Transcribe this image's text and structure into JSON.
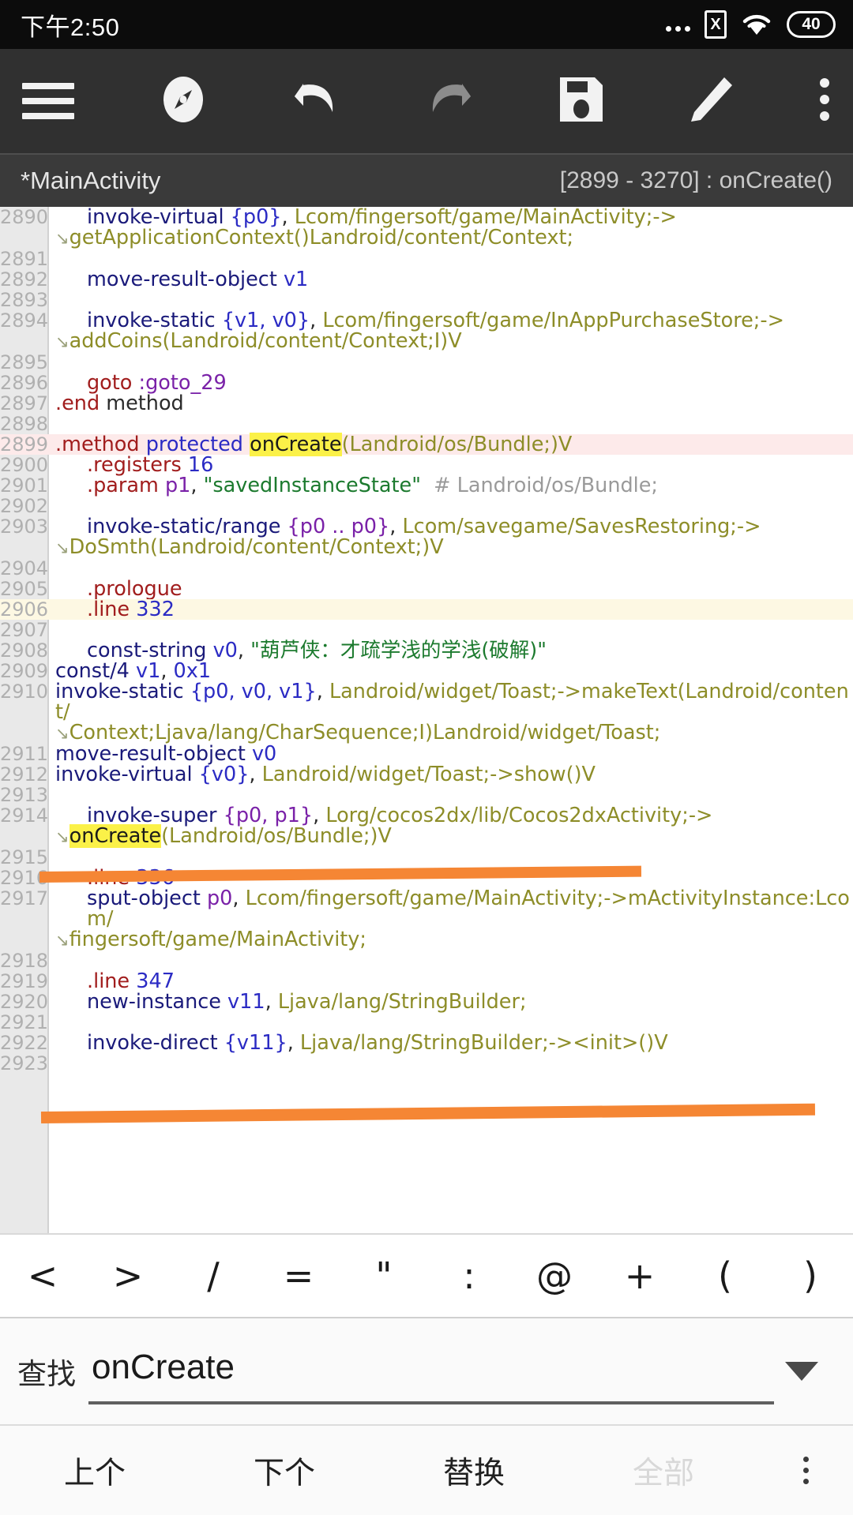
{
  "statusbar": {
    "time": "下午2:50",
    "battery": "40",
    "sim_glyph": "X",
    "icons": [
      "ellipsis-icon",
      "sim-x-icon",
      "wifi-icon",
      "battery-icon"
    ]
  },
  "toolbar": {
    "items": [
      {
        "name": "menu-button",
        "icon": "hamburger-icon",
        "enabled": true
      },
      {
        "name": "navigate-button",
        "icon": "compass-icon",
        "enabled": true
      },
      {
        "name": "undo-button",
        "icon": "undo-icon",
        "enabled": true
      },
      {
        "name": "redo-button",
        "icon": "redo-icon",
        "enabled": false
      },
      {
        "name": "save-button",
        "icon": "floppy-save-icon",
        "enabled": true
      },
      {
        "name": "edit-button",
        "icon": "pencil-icon",
        "enabled": true
      },
      {
        "name": "overflow-button",
        "icon": "more-vertical-icon",
        "enabled": true
      }
    ]
  },
  "breadcrumb": {
    "file": "*MainActivity",
    "range": "[2899 - 3270] : onCreate()"
  },
  "editor": {
    "search_term": "onCreate",
    "lines": [
      {
        "n": "2890",
        "indent": true,
        "wrap": false,
        "hl": "",
        "tokens": [
          {
            "t": "invoke-virtual",
            "c": "t-op"
          },
          {
            "t": " ",
            "c": "t-plain"
          },
          {
            "t": "{p0}",
            "c": "t-reg"
          },
          {
            "t": ", ",
            "c": "t-plain"
          },
          {
            "t": "Lcom/fingersoft/game/MainActivity;->",
            "c": "t-type"
          }
        ]
      },
      {
        "n": "",
        "indent": false,
        "wrap": true,
        "hl": "",
        "tokens": [
          {
            "t": "getApplicationContext()Landroid/content/Context;",
            "c": "t-type"
          }
        ]
      },
      {
        "n": "2891",
        "indent": false,
        "wrap": false,
        "hl": "",
        "tokens": []
      },
      {
        "n": "2892",
        "indent": true,
        "wrap": false,
        "hl": "",
        "tokens": [
          {
            "t": "move-result-object",
            "c": "t-op"
          },
          {
            "t": " ",
            "c": "t-plain"
          },
          {
            "t": "v1",
            "c": "t-reg"
          }
        ]
      },
      {
        "n": "2893",
        "indent": false,
        "wrap": false,
        "hl": "",
        "tokens": []
      },
      {
        "n": "2894",
        "indent": true,
        "wrap": false,
        "hl": "",
        "tokens": [
          {
            "t": "invoke-static",
            "c": "t-op"
          },
          {
            "t": " ",
            "c": "t-plain"
          },
          {
            "t": "{v1, v0}",
            "c": "t-reg"
          },
          {
            "t": ", ",
            "c": "t-plain"
          },
          {
            "t": "Lcom/fingersoft/game/InAppPurchaseStore;->",
            "c": "t-type"
          }
        ]
      },
      {
        "n": "",
        "indent": false,
        "wrap": true,
        "hl": "",
        "tokens": [
          {
            "t": "addCoins(Landroid/content/Context;I)V",
            "c": "t-type"
          }
        ]
      },
      {
        "n": "2895",
        "indent": false,
        "wrap": false,
        "hl": "",
        "tokens": []
      },
      {
        "n": "2896",
        "indent": true,
        "wrap": false,
        "hl": "",
        "tokens": [
          {
            "t": "goto",
            "c": "t-dir"
          },
          {
            "t": " ",
            "c": "t-plain"
          },
          {
            "t": ":goto_29",
            "c": "t-lbl"
          }
        ]
      },
      {
        "n": "2897",
        "indent": false,
        "wrap": false,
        "hl": "",
        "tokens": [
          {
            "t": ".end",
            "c": "t-dir"
          },
          {
            "t": " ",
            "c": "t-plain"
          },
          {
            "t": "method",
            "c": "t-plain"
          }
        ]
      },
      {
        "n": "2898",
        "indent": false,
        "wrap": false,
        "hl": "",
        "tokens": []
      },
      {
        "n": "2899",
        "indent": false,
        "wrap": false,
        "hl": "hl-pink",
        "tokens": [
          {
            "t": ".method",
            "c": "t-dir"
          },
          {
            "t": " ",
            "c": "t-plain"
          },
          {
            "t": "protected",
            "c": "t-kw"
          },
          {
            "t": " ",
            "c": "t-plain"
          },
          {
            "t": "onCreate",
            "c": "t-mark"
          },
          {
            "t": "(Landroid/os/Bundle;)V",
            "c": "t-type"
          }
        ]
      },
      {
        "n": "2900",
        "indent": true,
        "wrap": false,
        "hl": "",
        "tokens": [
          {
            "t": ".registers",
            "c": "t-dir"
          },
          {
            "t": " ",
            "c": "t-plain"
          },
          {
            "t": "16",
            "c": "t-num"
          }
        ]
      },
      {
        "n": "2901",
        "indent": true,
        "wrap": false,
        "hl": "",
        "tokens": [
          {
            "t": ".param",
            "c": "t-dir"
          },
          {
            "t": " ",
            "c": "t-plain"
          },
          {
            "t": "p1",
            "c": "t-preg"
          },
          {
            "t": ", ",
            "c": "t-plain"
          },
          {
            "t": "\"savedInstanceState\"",
            "c": "t-str"
          },
          {
            "t": "  ",
            "c": "t-plain"
          },
          {
            "t": "# Landroid/os/Bundle;",
            "c": "t-cmt"
          }
        ]
      },
      {
        "n": "2902",
        "indent": false,
        "wrap": false,
        "hl": "",
        "tokens": []
      },
      {
        "n": "2903",
        "indent": true,
        "wrap": false,
        "hl": "",
        "tokens": [
          {
            "t": "invoke-static/range",
            "c": "t-op"
          },
          {
            "t": " ",
            "c": "t-plain"
          },
          {
            "t": "{p0 .. p0}",
            "c": "t-preg"
          },
          {
            "t": ", ",
            "c": "t-plain"
          },
          {
            "t": "Lcom/savegame/SavesRestoring;->",
            "c": "t-type"
          }
        ]
      },
      {
        "n": "",
        "indent": false,
        "wrap": true,
        "hl": "",
        "tokens": [
          {
            "t": "DoSmth(Landroid/content/Context;)V",
            "c": "t-type"
          }
        ]
      },
      {
        "n": "2904",
        "indent": false,
        "wrap": false,
        "hl": "",
        "tokens": []
      },
      {
        "n": "2905",
        "indent": true,
        "wrap": false,
        "hl": "",
        "tokens": [
          {
            "t": ".prologue",
            "c": "t-dir"
          }
        ]
      },
      {
        "n": "2906",
        "indent": true,
        "wrap": false,
        "hl": "hl-cream",
        "tokens": [
          {
            "t": ".line",
            "c": "t-dir"
          },
          {
            "t": " ",
            "c": "t-plain"
          },
          {
            "t": "332",
            "c": "t-num"
          }
        ]
      },
      {
        "n": "2907",
        "indent": false,
        "wrap": false,
        "hl": "",
        "tokens": []
      },
      {
        "n": "2908",
        "indent": true,
        "wrap": false,
        "hl": "",
        "tokens": [
          {
            "t": "const-string",
            "c": "t-op"
          },
          {
            "t": " ",
            "c": "t-plain"
          },
          {
            "t": "v0",
            "c": "t-reg"
          },
          {
            "t": ", ",
            "c": "t-plain"
          },
          {
            "t": "\"葫芦侠：才疏学浅的学浅(破解)\"",
            "c": "t-str"
          }
        ]
      },
      {
        "n": "2909",
        "indent": false,
        "wrap": false,
        "hl": "",
        "tokens": [
          {
            "t": "const/4",
            "c": "t-op"
          },
          {
            "t": " ",
            "c": "t-plain"
          },
          {
            "t": "v1",
            "c": "t-reg"
          },
          {
            "t": ", ",
            "c": "t-plain"
          },
          {
            "t": "0x1",
            "c": "t-num"
          }
        ]
      },
      {
        "n": "2910",
        "indent": false,
        "wrap": false,
        "hl": "",
        "tokens": [
          {
            "t": "invoke-static",
            "c": "t-op"
          },
          {
            "t": " ",
            "c": "t-plain"
          },
          {
            "t": "{p0, v0, v1}",
            "c": "t-reg"
          },
          {
            "t": ", ",
            "c": "t-plain"
          },
          {
            "t": "Landroid/widget/Toast;->makeText(Landroid/content/",
            "c": "t-type"
          }
        ]
      },
      {
        "n": "",
        "indent": false,
        "wrap": true,
        "hl": "",
        "tokens": [
          {
            "t": "Context;Ljava/lang/CharSequence;I)Landroid/widget/Toast;",
            "c": "t-type"
          }
        ]
      },
      {
        "n": "2911",
        "indent": false,
        "wrap": false,
        "hl": "",
        "tokens": [
          {
            "t": "move-result-object",
            "c": "t-op"
          },
          {
            "t": " ",
            "c": "t-plain"
          },
          {
            "t": "v0",
            "c": "t-reg"
          }
        ]
      },
      {
        "n": "2912",
        "indent": false,
        "wrap": false,
        "hl": "",
        "tokens": [
          {
            "t": "invoke-virtual",
            "c": "t-op"
          },
          {
            "t": " ",
            "c": "t-plain"
          },
          {
            "t": "{v0}",
            "c": "t-reg"
          },
          {
            "t": ", ",
            "c": "t-plain"
          },
          {
            "t": "Landroid/widget/Toast;->show()V",
            "c": "t-type"
          }
        ]
      },
      {
        "n": "2913",
        "indent": false,
        "wrap": false,
        "hl": "",
        "tokens": []
      },
      {
        "n": "2914",
        "indent": true,
        "wrap": false,
        "hl": "",
        "tokens": [
          {
            "t": "invoke-super",
            "c": "t-op"
          },
          {
            "t": " ",
            "c": "t-plain"
          },
          {
            "t": "{p0, p1}",
            "c": "t-preg"
          },
          {
            "t": ", ",
            "c": "t-plain"
          },
          {
            "t": "Lorg/cocos2dx/lib/Cocos2dxActivity;->",
            "c": "t-type"
          }
        ]
      },
      {
        "n": "",
        "indent": false,
        "wrap": true,
        "hl": "",
        "tokens": [
          {
            "t": "onCreate",
            "c": "t-mark"
          },
          {
            "t": "(Landroid/os/Bundle;)V",
            "c": "t-type"
          }
        ]
      },
      {
        "n": "2915",
        "indent": false,
        "wrap": false,
        "hl": "",
        "tokens": []
      },
      {
        "n": "2916",
        "indent": true,
        "wrap": false,
        "hl": "",
        "tokens": [
          {
            "t": ".line",
            "c": "t-dir"
          },
          {
            "t": " ",
            "c": "t-plain"
          },
          {
            "t": "336",
            "c": "t-num"
          }
        ]
      },
      {
        "n": "2917",
        "indent": true,
        "wrap": false,
        "hl": "",
        "tokens": [
          {
            "t": "sput-object",
            "c": "t-op"
          },
          {
            "t": " ",
            "c": "t-plain"
          },
          {
            "t": "p0",
            "c": "t-preg"
          },
          {
            "t": ", ",
            "c": "t-plain"
          },
          {
            "t": "Lcom/fingersoft/game/MainActivity;->mActivityInstance:Lcom/",
            "c": "t-type"
          }
        ]
      },
      {
        "n": "",
        "indent": false,
        "wrap": true,
        "hl": "",
        "tokens": [
          {
            "t": "fingersoft/game/MainActivity;",
            "c": "t-type"
          }
        ]
      },
      {
        "n": "2918",
        "indent": false,
        "wrap": false,
        "hl": "",
        "tokens": []
      },
      {
        "n": "2919",
        "indent": true,
        "wrap": false,
        "hl": "",
        "tokens": [
          {
            "t": ".line",
            "c": "t-dir"
          },
          {
            "t": " ",
            "c": "t-plain"
          },
          {
            "t": "347",
            "c": "t-num"
          }
        ]
      },
      {
        "n": "2920",
        "indent": true,
        "wrap": false,
        "hl": "",
        "tokens": [
          {
            "t": "new-instance",
            "c": "t-op"
          },
          {
            "t": " ",
            "c": "t-plain"
          },
          {
            "t": "v11",
            "c": "t-reg"
          },
          {
            "t": ", ",
            "c": "t-plain"
          },
          {
            "t": "Ljava/lang/StringBuilder;",
            "c": "t-type"
          }
        ]
      },
      {
        "n": "2921",
        "indent": false,
        "wrap": false,
        "hl": "",
        "tokens": []
      },
      {
        "n": "2922",
        "indent": true,
        "wrap": false,
        "hl": "",
        "tokens": [
          {
            "t": "invoke-direct",
            "c": "t-op"
          },
          {
            "t": " ",
            "c": "t-plain"
          },
          {
            "t": "{v11}",
            "c": "t-reg"
          },
          {
            "t": ", ",
            "c": "t-plain"
          },
          {
            "t": "Ljava/lang/StringBuilder;-><init>()V",
            "c": "t-type"
          }
        ]
      },
      {
        "n": "2923",
        "indent": false,
        "wrap": false,
        "hl": "",
        "tokens": []
      }
    ],
    "annotations": [
      {
        "name": "orange-marker-stroke-1",
        "color": "#f58634",
        "near_line": "2904"
      },
      {
        "name": "orange-marker-stroke-2",
        "color": "#f58634",
        "near_line": "2913"
      }
    ]
  },
  "symbol_bar": {
    "keys": [
      "<",
      ">",
      "/",
      "=",
      "\"",
      ":",
      "@",
      "+",
      "(",
      ")"
    ]
  },
  "search": {
    "label": "查找",
    "value": "onCreate",
    "placeholder": "",
    "dropdown_icon": "chevron-down-icon"
  },
  "actions": {
    "items": [
      {
        "label": "上个",
        "name": "find-previous-button",
        "enabled": true
      },
      {
        "label": "下个",
        "name": "find-next-button",
        "enabled": true
      },
      {
        "label": "替换",
        "name": "replace-button",
        "enabled": true
      },
      {
        "label": "全部",
        "name": "replace-all-button",
        "enabled": false
      }
    ],
    "overflow_icon": "more-vertical-icon"
  },
  "colors": {
    "accent_orange": "#f58634",
    "highlight_yellow": "#fbf148",
    "toolbar_bg": "#303030",
    "statusbar_bg": "#0c0c0c",
    "crumb_bg": "#3a3a3a"
  }
}
